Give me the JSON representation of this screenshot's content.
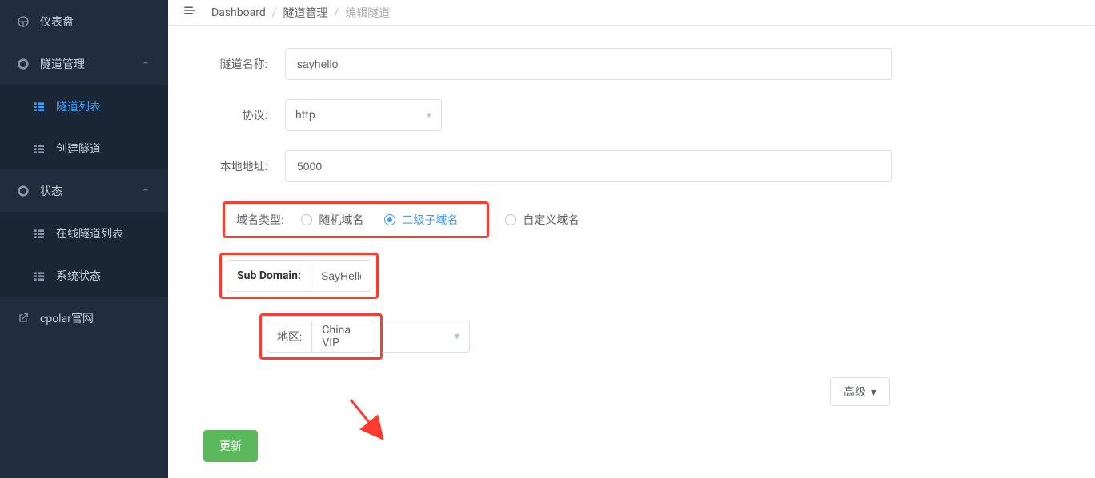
{
  "sidebar": {
    "items": [
      {
        "icon": "dashboard-icon",
        "label": "仪表盘"
      },
      {
        "icon": "tunnel-icon",
        "label": "隧道管理",
        "chevron": true
      },
      {
        "icon": "list-icon",
        "label": "隧道列表",
        "sub": true,
        "active": true
      },
      {
        "icon": "create-icon",
        "label": "创建隧道",
        "sub": true
      },
      {
        "icon": "status-icon",
        "label": "状态",
        "chevron": true
      },
      {
        "icon": "online-icon",
        "label": "在线隧道列表",
        "sub": true
      },
      {
        "icon": "sys-icon",
        "label": "系统状态",
        "sub": true
      },
      {
        "icon": "link-icon",
        "label": "cpolar官网"
      }
    ]
  },
  "breadcrumb": {
    "a": "Dashboard",
    "b": "隧道管理",
    "c": "编辑隧道"
  },
  "form": {
    "name_label": "隧道名称:",
    "name_value": "sayhello",
    "proto_label": "协议:",
    "proto_value": "http",
    "local_label": "本地地址:",
    "local_value": "5000",
    "domain_type_label": "域名类型:",
    "domain_opts": {
      "random": "随机域名",
      "sub": "二级子域名",
      "custom": "自定义域名"
    },
    "subdomain_label": "Sub Domain:",
    "subdomain_value": "SayHello",
    "region_label": "地区:",
    "region_value": "China VIP",
    "advanced_label": "高级",
    "update_label": "更新"
  }
}
